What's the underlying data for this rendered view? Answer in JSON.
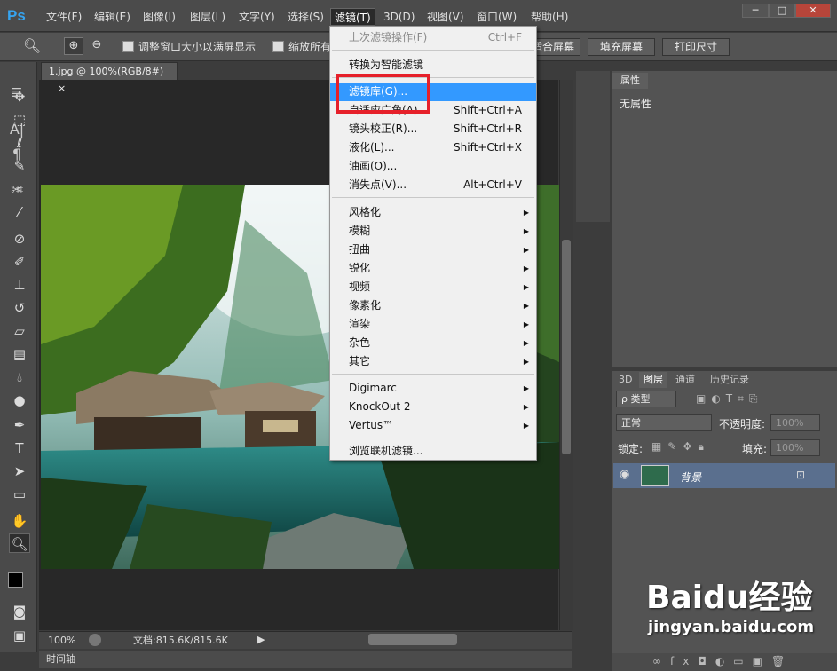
{
  "app": {
    "logo": "Ps"
  },
  "menubar": [
    "文件(F)",
    "编辑(E)",
    "图像(I)",
    "图层(L)",
    "文字(Y)",
    "选择(S)",
    "滤镜(T)",
    "3D(D)",
    "视图(V)",
    "窗口(W)",
    "帮助(H)"
  ],
  "window_buttons": {
    "minimize": "─",
    "maximize": "□",
    "close": "✕"
  },
  "options_bar": {
    "resize_window_label": "调整窗口大小以满屏显示",
    "zoom_all_label": "缩放所有",
    "fit_screen": "适合屏幕",
    "fill_screen": "填充屏幕",
    "print_size": "打印尺寸"
  },
  "document": {
    "tab_title": "1.jpg @ 100%(RGB/8#)",
    "close": "×",
    "zoom": "100%",
    "doc_info": "文档:815.6K/815.6K",
    "timeline": "时间轴"
  },
  "filter_menu": {
    "last_filter": {
      "label": "上次滤镜操作(F)",
      "shortcut": "Ctrl+F"
    },
    "smart": "转换为智能滤镜",
    "gallery": "滤镜库(G)...",
    "adaptive_wide": {
      "label": "自适应广角(A)...",
      "shortcut": "Shift+Ctrl+A"
    },
    "lens_correction": {
      "label": "镜头校正(R)...",
      "shortcut": "Shift+Ctrl+R"
    },
    "liquify": {
      "label": "液化(L)...",
      "shortcut": "Shift+Ctrl+X"
    },
    "oil_paint": "油画(O)...",
    "vanishing_point": {
      "label": "消失点(V)...",
      "shortcut": "Alt+Ctrl+V"
    },
    "submenus": [
      "风格化",
      "模糊",
      "扭曲",
      "锐化",
      "视频",
      "像素化",
      "渲染",
      "杂色",
      "其它"
    ],
    "plugins": [
      "Digimarc",
      "KnockOut 2",
      "Vertus™"
    ],
    "browse": "浏览联机滤镜..."
  },
  "properties_panel": {
    "tab": "属性",
    "empty": "无属性"
  },
  "layers_panel": {
    "tabs": [
      "3D",
      "图层",
      "通道",
      "历史记录"
    ],
    "filter_kind": "ρ 类型",
    "blend_mode": "正常",
    "opacity_label": "不透明度:",
    "opacity_value": "100%",
    "lock_label": "锁定:",
    "fill_label": "填充:",
    "fill_value": "100%",
    "layer_name": "背景"
  },
  "watermark": {
    "brand": "Baidu经验",
    "url": "jingyan.baidu.com"
  }
}
